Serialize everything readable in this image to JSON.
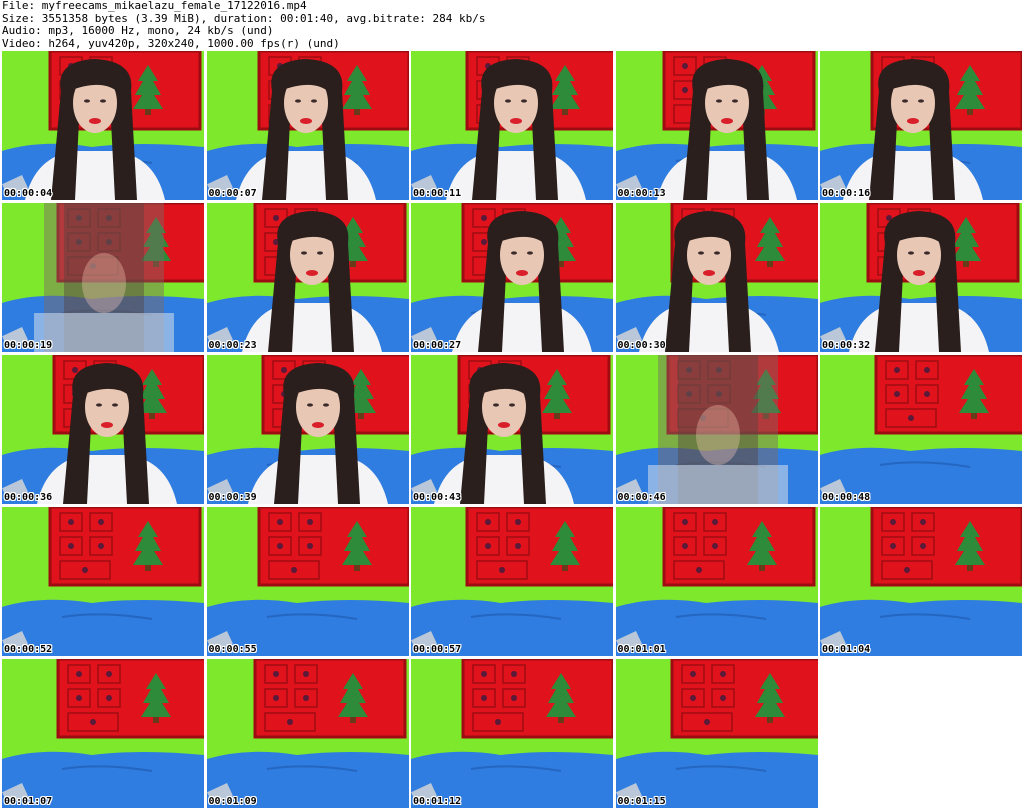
{
  "header": {
    "file_line": "File: myfreecams_mikaelazu_female_17122016.mp4",
    "size_line": "Size: 3551358 bytes (3.39 MiB), duration: 00:01:40, avg.bitrate: 284 kb/s",
    "audio_line": "Audio: mp3, 16000 Hz, mono, 24 kb/s (und)",
    "video_line": "Video: h264, yuv420p, 320x240, 1000.00 fps(r) (und)"
  },
  "colors": {
    "wall_green": "#7ee82c",
    "board_red": "#e0121b",
    "board_dark": "#9e0c12",
    "sofa_blue": "#2f7de0",
    "tree_green": "#2e8b3a",
    "hair": "#2a1f1c",
    "skin": "#e8c7b4",
    "lips": "#d81f2a",
    "shirt": "#f4f4f6"
  },
  "thumbnails": [
    {
      "timestamp": "00:00:04",
      "person": "present"
    },
    {
      "timestamp": "00:00:07",
      "person": "present"
    },
    {
      "timestamp": "00:00:11",
      "person": "present"
    },
    {
      "timestamp": "00:00:13",
      "person": "present"
    },
    {
      "timestamp": "00:00:16",
      "person": "present"
    },
    {
      "timestamp": "00:00:19",
      "person": "blurred"
    },
    {
      "timestamp": "00:00:23",
      "person": "present"
    },
    {
      "timestamp": "00:00:27",
      "person": "present"
    },
    {
      "timestamp": "00:00:30",
      "person": "present"
    },
    {
      "timestamp": "00:00:32",
      "person": "present"
    },
    {
      "timestamp": "00:00:36",
      "person": "present"
    },
    {
      "timestamp": "00:00:39",
      "person": "present"
    },
    {
      "timestamp": "00:00:43",
      "person": "present"
    },
    {
      "timestamp": "00:00:46",
      "person": "blurred"
    },
    {
      "timestamp": "00:00:48",
      "person": "absent"
    },
    {
      "timestamp": "00:00:52",
      "person": "absent"
    },
    {
      "timestamp": "00:00:55",
      "person": "absent"
    },
    {
      "timestamp": "00:00:57",
      "person": "absent"
    },
    {
      "timestamp": "00:01:01",
      "person": "absent"
    },
    {
      "timestamp": "00:01:04",
      "person": "absent"
    },
    {
      "timestamp": "00:01:07",
      "person": "absent"
    },
    {
      "timestamp": "00:01:09",
      "person": "absent"
    },
    {
      "timestamp": "00:01:12",
      "person": "absent"
    },
    {
      "timestamp": "00:01:15",
      "person": "absent"
    }
  ]
}
